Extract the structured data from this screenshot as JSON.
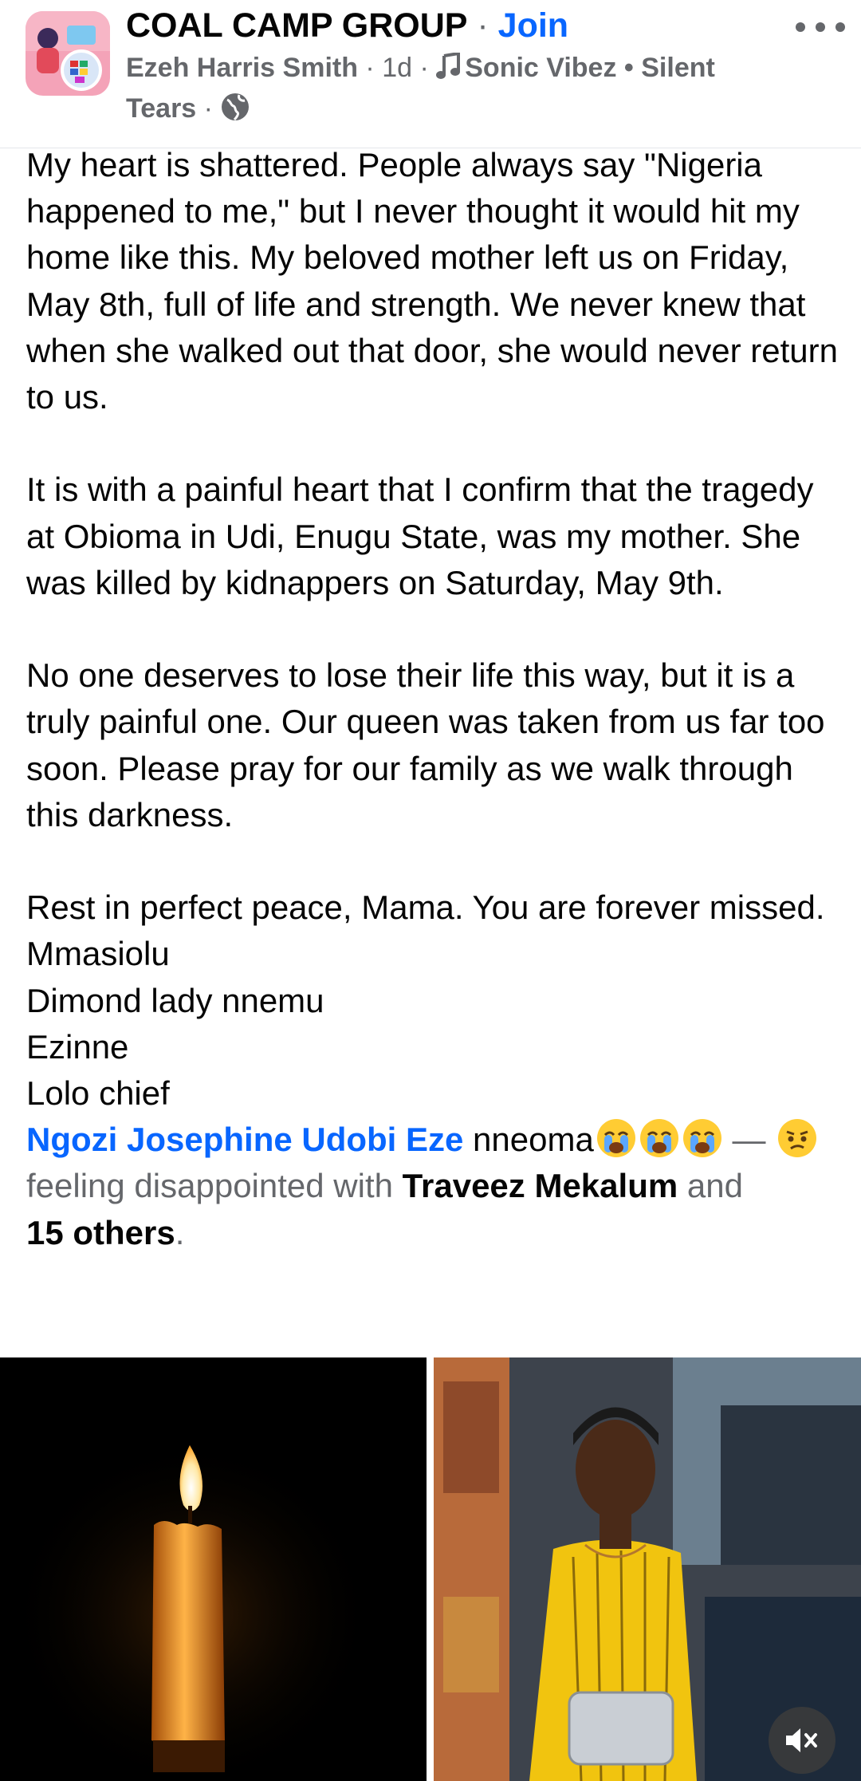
{
  "header": {
    "group_name": "COAL CAMP GROUP",
    "separator": " · ",
    "join_label": "Join",
    "author": "Ezeh Harris Smith",
    "dot1": " · ",
    "time": "1d",
    "dot2": " · ",
    "music": "Sonic Vibez • Silent Tears",
    "dot3": " · ",
    "more_icon": "more-horizontal-icon",
    "privacy_icon": "globe-icon"
  },
  "post": {
    "paragraphs": [
      "My heart is shattered. People always say \"Nigeria happened to me,\" but I never thought it would hit my home like this. My beloved mother left us on Friday, May 8th, full of life and strength. We never knew that when she walked out that door, she would never return to us.",
      "It is with a painful heart that I confirm that the tragedy at Obioma in Udi, Enugu State, was my mother. She was killed by kidnappers on Saturday, May 9th.",
      "No one deserves to lose their life this way, but it is a truly painful one. Our queen was taken from us far too soon. Please pray for our family as we walk through this darkness."
    ],
    "closing": "Rest in perfect peace, Mama. You are forever missed.",
    "lines": [
      "Mmasiolu",
      "Dimond lady nnemu",
      "Ezinne",
      "Lolo chief"
    ],
    "tagged_name": "Ngozi Josephine Udobi Eze",
    "tagged_after": " nneoma",
    "dash": " — ",
    "feeling_text": "feeling disappointed with ",
    "with_name": "Traveez Mekalum",
    "and_text": " and ",
    "others": "15 others",
    "period": "."
  },
  "photos": {
    "left": "candle-photo",
    "right": "woman-photo",
    "mute_icon": "volume-muted-icon"
  },
  "colors": {
    "link": "#0866ff",
    "muted": "#65676b",
    "text": "#050505"
  }
}
